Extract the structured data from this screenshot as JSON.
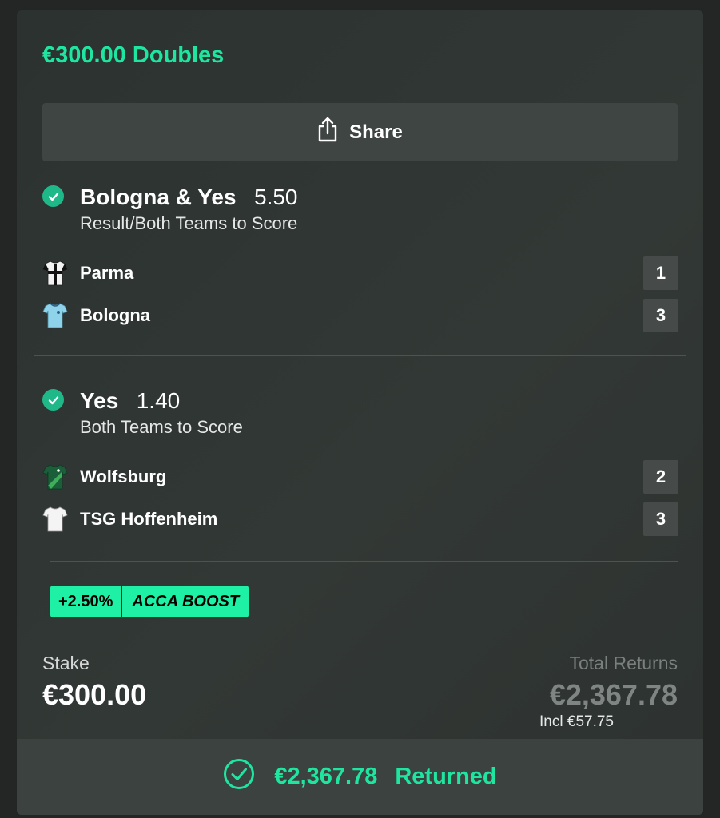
{
  "bet": {
    "title": "€300.00 Doubles",
    "share_label": "Share"
  },
  "selections": [
    {
      "name": "Bologna & Yes",
      "odds": "5.50",
      "market": "Result/Both Teams to Score",
      "teams": [
        {
          "name": "Parma",
          "score": "1",
          "kit": "parma-shirt-icon"
        },
        {
          "name": "Bologna",
          "score": "3",
          "kit": "bologna-shirt-icon"
        }
      ]
    },
    {
      "name": "Yes",
      "odds": "1.40",
      "market": "Both Teams to Score",
      "teams": [
        {
          "name": "Wolfsburg",
          "score": "2",
          "kit": "wolfsburg-shirt-icon"
        },
        {
          "name": "TSG Hoffenheim",
          "score": "3",
          "kit": "hoffenheim-shirt-icon"
        }
      ]
    }
  ],
  "boost": {
    "percent": "+2.50%",
    "label": "ACCA BOOST"
  },
  "stake": {
    "label": "Stake",
    "value": "€300.00"
  },
  "returns": {
    "label": "Total Returns",
    "value": "€2,367.78",
    "incl": "Incl €57.75"
  },
  "result": {
    "amount": "€2,367.78",
    "status": "Returned"
  },
  "colors": {
    "accent": "#1ee6a0",
    "check": "#1fb889",
    "card": "#323835"
  }
}
